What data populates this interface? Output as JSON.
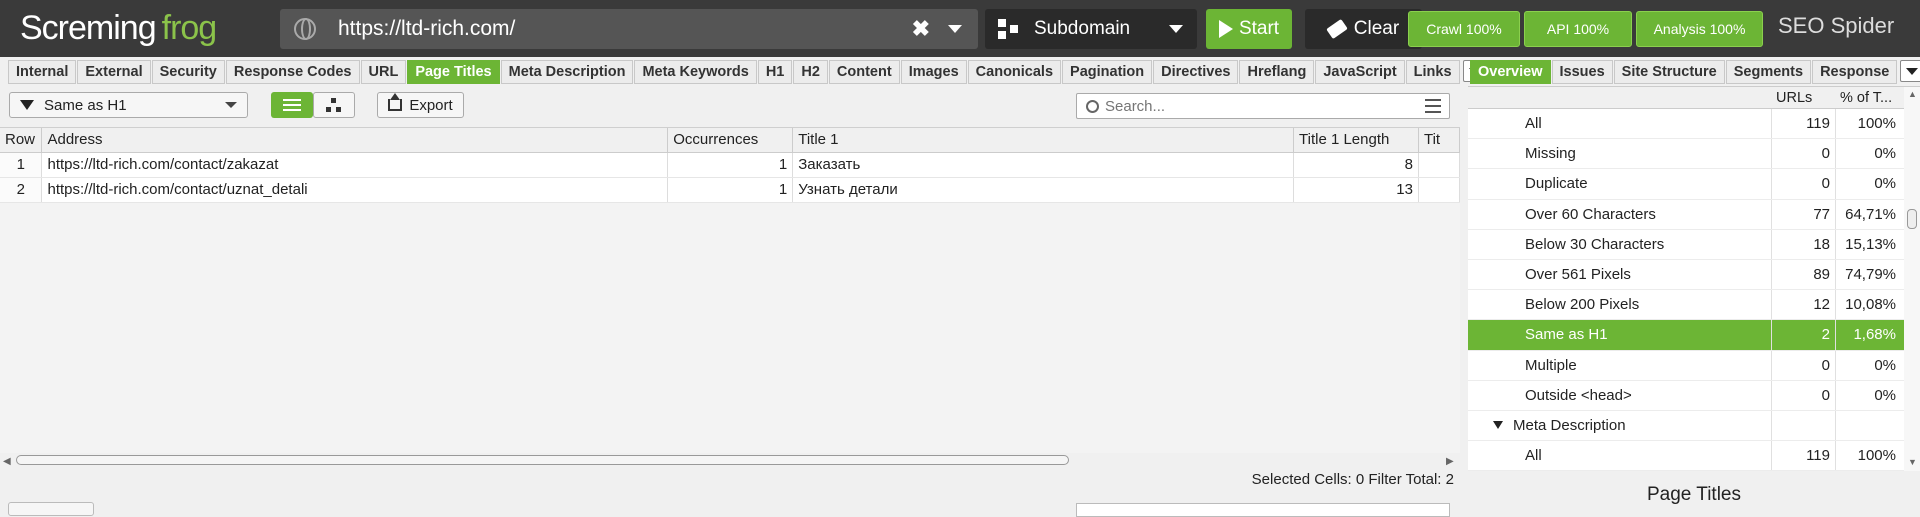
{
  "app": {
    "logo_part1": "Scre",
    "logo_part2": "ming",
    "logo_part3": "frog",
    "brand": "SEO Spider"
  },
  "urlbar": {
    "url": "https://ltd-rich.com/",
    "clear_glyph": "✖"
  },
  "mode": {
    "label": "Subdomain"
  },
  "buttons": {
    "start": "Start",
    "clear": "Clear",
    "crawl": "Crawl 100%",
    "api": "API 100%",
    "analysis": "Analysis 100%"
  },
  "tabs": [
    "Internal",
    "External",
    "Security",
    "Response Codes",
    "URL",
    "Page Titles",
    "Meta Description",
    "Meta Keywords",
    "H1",
    "H2",
    "Content",
    "Images",
    "Canonicals",
    "Pagination",
    "Directives",
    "Hreflang",
    "JavaScript",
    "Links"
  ],
  "active_tab": "Page Titles",
  "right_tabs": [
    "Overview",
    "Issues",
    "Site Structure",
    "Segments",
    "Response"
  ],
  "active_right_tab": "Overview",
  "toolbar": {
    "filter": "Same as H1",
    "export": "Export",
    "search_placeholder": "Search..."
  },
  "table": {
    "columns": [
      "Row",
      "Address",
      "Occurrences",
      "Title 1",
      "Title 1 Length",
      "Tit"
    ],
    "rows": [
      [
        "1",
        "https://ltd-rich.com/contact/zakazat",
        "1",
        "Заказать",
        "8",
        ""
      ],
      [
        "2",
        "https://ltd-rich.com/contact/uznat_detali",
        "1",
        "Узнать детали",
        "13",
        ""
      ]
    ]
  },
  "status": {
    "text": "Selected Cells:  0  Filter Total:  2"
  },
  "overview": {
    "col_urls": "URLs",
    "col_pct": "% of T...",
    "rows": [
      {
        "label": "All",
        "urls": "119",
        "pct": "100%"
      },
      {
        "label": "Missing",
        "urls": "0",
        "pct": "0%"
      },
      {
        "label": "Duplicate",
        "urls": "0",
        "pct": "0%"
      },
      {
        "label": "Over 60 Characters",
        "urls": "77",
        "pct": "64,71%"
      },
      {
        "label": "Below 30 Characters",
        "urls": "18",
        "pct": "15,13%"
      },
      {
        "label": "Over 561 Pixels",
        "urls": "89",
        "pct": "74,79%"
      },
      {
        "label": "Below 200 Pixels",
        "urls": "12",
        "pct": "10,08%"
      },
      {
        "label": "Same as H1",
        "urls": "2",
        "pct": "1,68%"
      },
      {
        "label": "Multiple",
        "urls": "0",
        "pct": "0%"
      },
      {
        "label": "Outside <head>",
        "urls": "0",
        "pct": "0%"
      },
      {
        "label": "Meta Description",
        "urls": "",
        "pct": ""
      },
      {
        "label": "All",
        "urls": "119",
        "pct": "100%"
      }
    ],
    "selected_label": "Same as H1",
    "group_label": "Meta Description"
  },
  "panel_title": "Page Titles",
  "colors": {
    "accent": "#6cb535",
    "topbar": "#3a3a3a"
  }
}
